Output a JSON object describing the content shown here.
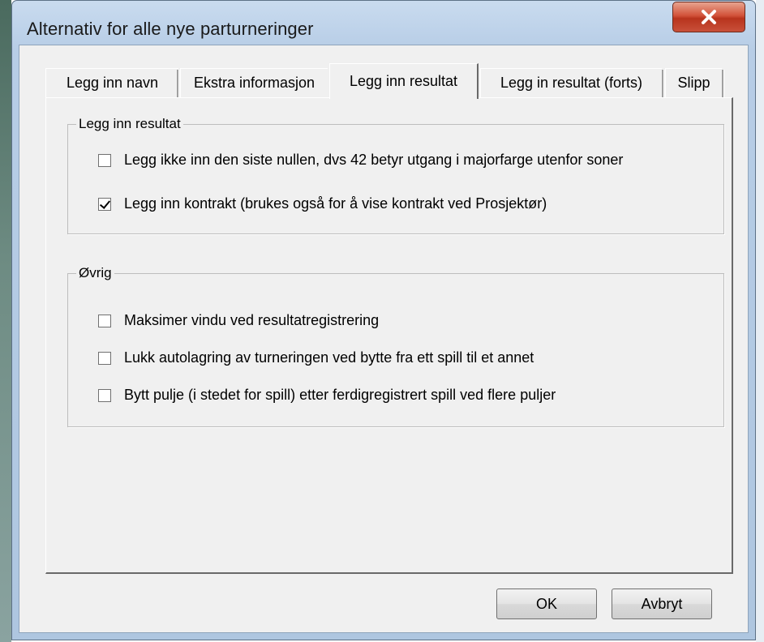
{
  "window": {
    "title": "Alternativ for alle nye parturneringer",
    "close_icon": "close-icon"
  },
  "tabs": [
    {
      "label": "Legg inn navn",
      "active": false
    },
    {
      "label": "Ekstra informasjon",
      "active": false
    },
    {
      "label": "Legg inn resultat",
      "active": true
    },
    {
      "label": "Legg in resultat (forts)",
      "active": false
    },
    {
      "label": "Slipp",
      "active": false
    }
  ],
  "groups": [
    {
      "label": "Legg inn resultat",
      "options": [
        {
          "label": "Legg ikke inn den siste nullen, dvs 42 betyr utgang i majorfarge utenfor soner",
          "checked": false
        },
        {
          "label": "Legg inn kontrakt (brukes også for å vise kontrakt ved Prosjektør)",
          "checked": true
        }
      ]
    },
    {
      "label": "Øvrig",
      "options": [
        {
          "label": "Maksimer vindu ved resultatregistrering",
          "checked": false
        },
        {
          "label": "Lukk autolagring av turneringen ved bytte fra ett spill til et annet",
          "checked": false
        },
        {
          "label": "Bytt pulje (i stedet for spill) etter ferdigregistrert spill ved flere puljer",
          "checked": false
        }
      ]
    }
  ],
  "buttons": {
    "ok": "OK",
    "cancel": "Avbryt"
  },
  "colors": {
    "close_button": "#c8432a",
    "title_bar": "#b9cfe7",
    "dialog_bg": "#f0f0f0"
  }
}
